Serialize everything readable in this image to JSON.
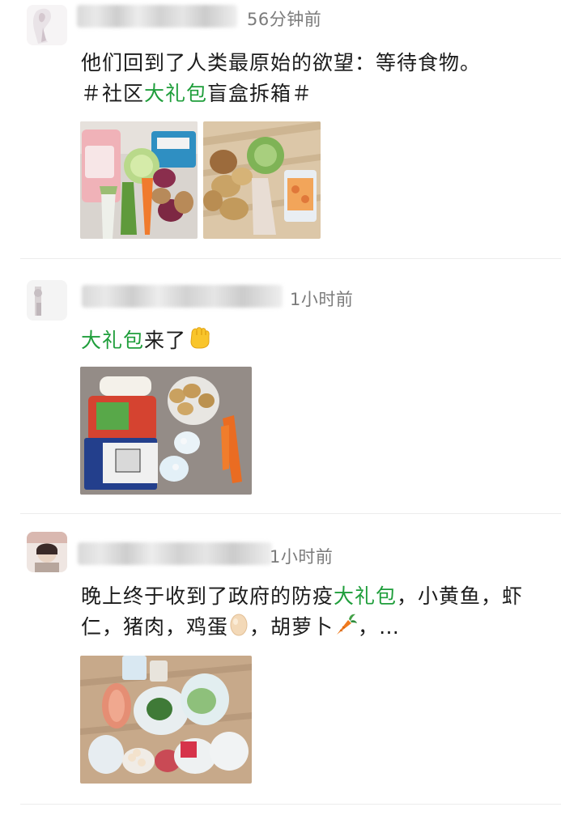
{
  "posts": [
    {
      "time": "56分钟前",
      "text_parts": [
        {
          "text": "他们回到了人类最原始的欲望：等待食物。",
          "highlight": false
        },
        {
          "text": "＃社区",
          "highlight": false
        },
        {
          "text": "大礼包",
          "highlight": true
        },
        {
          "text": "盲盒拆箱＃",
          "highlight": false
        }
      ],
      "images": 2
    },
    {
      "time": "1小时前",
      "text_parts": [
        {
          "text": "大礼包",
          "highlight": true
        },
        {
          "text": "来了",
          "highlight": false
        }
      ],
      "emoji": "fist-icon",
      "images": 1
    },
    {
      "time": "1小时前",
      "text_parts": [
        {
          "text": "晚上终于收到了政府的防疫",
          "highlight": false
        },
        {
          "text": "大礼包",
          "highlight": true
        },
        {
          "text": "，小黄鱼，虾仁，猪肉，鸡蛋",
          "highlight": false
        },
        {
          "text": "，胡萝卜",
          "highlight": false
        },
        {
          "text": "，…",
          "highlight": false
        }
      ],
      "emojis": [
        "egg-icon",
        "carrot-icon"
      ],
      "images": 1
    }
  ],
  "colors": {
    "highlight": "#1f9e3b",
    "time": "#7b7b7b",
    "text": "#1b1b1b"
  }
}
